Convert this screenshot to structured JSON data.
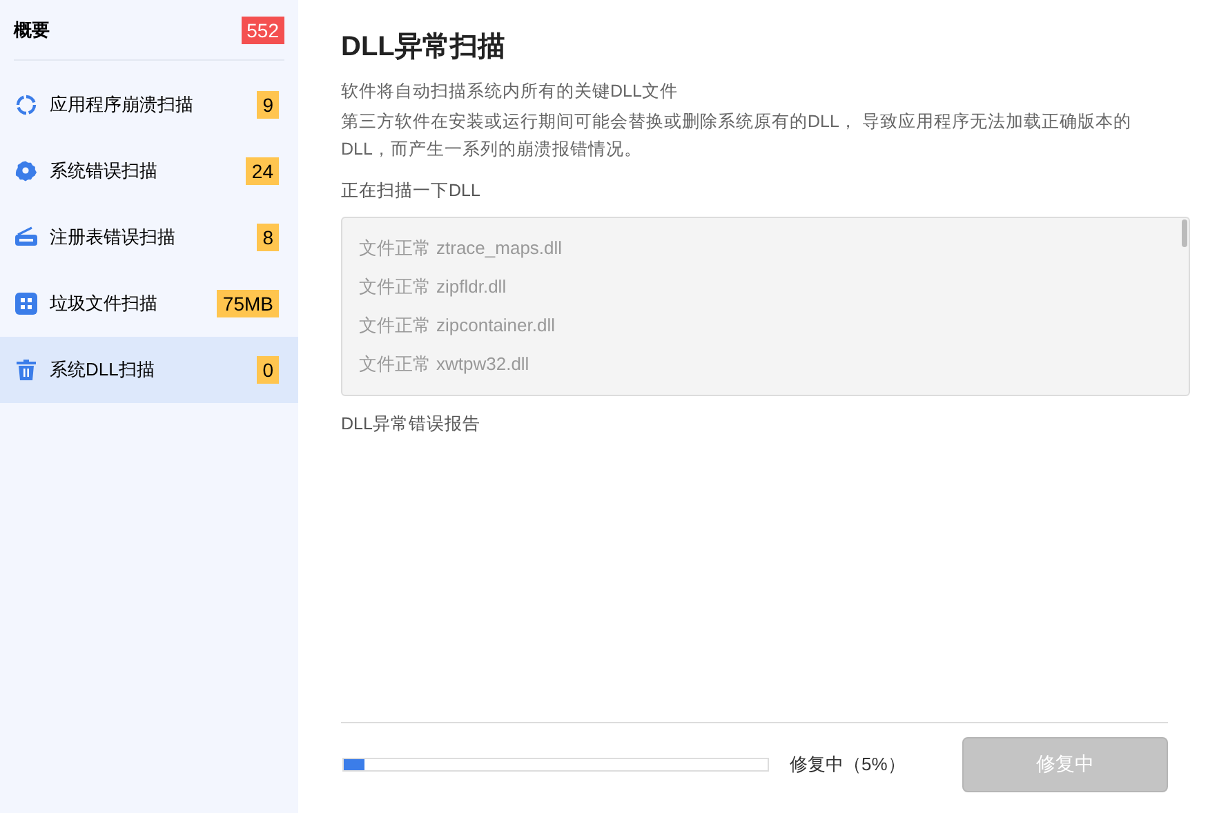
{
  "sidebar": {
    "overview": {
      "label": "概要",
      "count": "552"
    },
    "items": [
      {
        "label": "应用程序崩溃扫描",
        "count": "9",
        "selected": false
      },
      {
        "label": "系统错误扫描",
        "count": "24",
        "selected": false
      },
      {
        "label": "注册表错误扫描",
        "count": "8",
        "selected": false
      },
      {
        "label": "垃圾文件扫描",
        "count": "75MB",
        "selected": false
      },
      {
        "label": "系统DLL扫描",
        "count": "0",
        "selected": true
      }
    ]
  },
  "main": {
    "title": "DLL异常扫描",
    "description": [
      "软件将自动扫描系统内所有的关键DLL文件",
      "第三方软件在安装或运行期间可能会替换或删除系统原有的DLL， 导致应用程序无法加载正确版本的DLL，而产生一系列的崩溃报错情况。"
    ],
    "scan_label": "正在扫描一下DLL",
    "scan_log": [
      {
        "status": "文件正常",
        "file": "ztrace_maps.dll"
      },
      {
        "status": "文件正常",
        "file": "zipfldr.dll"
      },
      {
        "status": "文件正常",
        "file": "zipcontainer.dll"
      },
      {
        "status": "文件正常",
        "file": "xwtpw32.dll"
      }
    ],
    "report_label": "DLL异常错误报告",
    "progress": {
      "level": 0.05,
      "text": "修复中（5%）"
    },
    "button": {
      "label": "修复中",
      "disabled": true
    }
  }
}
